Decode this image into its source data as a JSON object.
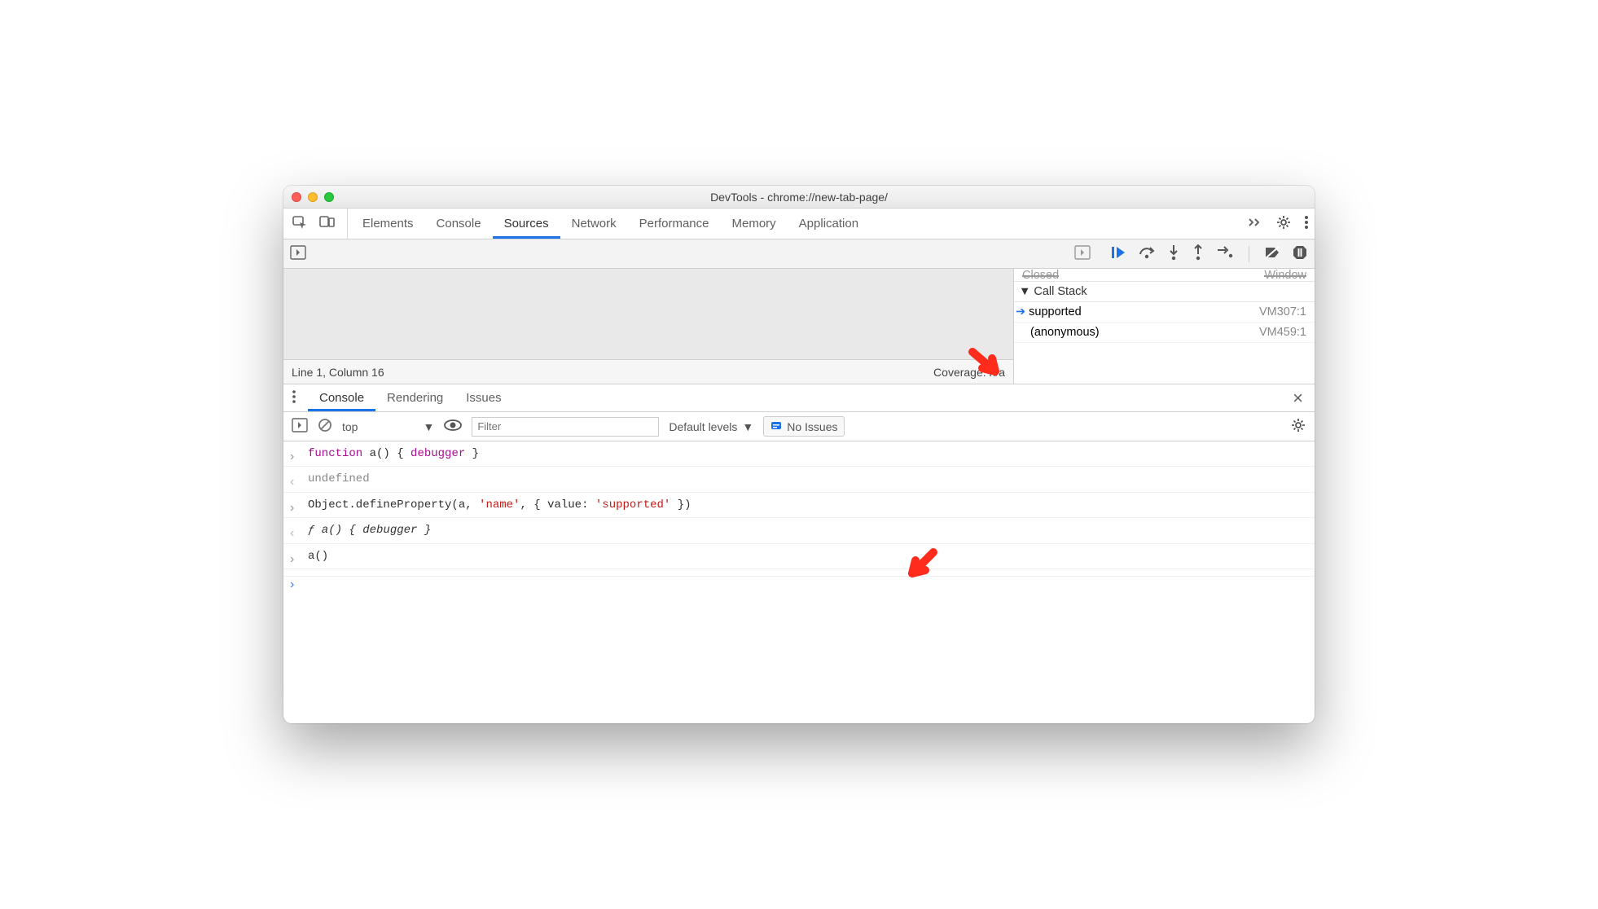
{
  "window": {
    "title": "DevTools - chrome://new-tab-page/"
  },
  "main_tabs": {
    "items": [
      {
        "label": "Elements"
      },
      {
        "label": "Console"
      },
      {
        "label": "Sources",
        "active": true
      },
      {
        "label": "Network"
      },
      {
        "label": "Performance"
      },
      {
        "label": "Memory"
      },
      {
        "label": "Application"
      }
    ]
  },
  "src_status": {
    "left": "Line 1, Column 16",
    "right": "Coverage: n/a"
  },
  "truncated": {
    "left": "Closed",
    "right": "Window"
  },
  "call_stack": {
    "title": "Call Stack",
    "frames": [
      {
        "name": "supported",
        "loc": "VM307:1",
        "active": true
      },
      {
        "name": "(anonymous)",
        "loc": "VM459:1",
        "active": false
      }
    ]
  },
  "drawer_tabs": {
    "items": [
      {
        "label": "Console",
        "active": true
      },
      {
        "label": "Rendering"
      },
      {
        "label": "Issues"
      }
    ]
  },
  "console_toolbar": {
    "context": "top",
    "filter_placeholder": "Filter",
    "levels": "Default levels",
    "issues_chip": "No Issues"
  },
  "console_lines": [
    {
      "kind": "input",
      "segments": [
        {
          "t": "function ",
          "c": "kw"
        },
        {
          "t": "a() { "
        },
        {
          "t": "debugger",
          "c": "kw"
        },
        {
          "t": " }"
        }
      ]
    },
    {
      "kind": "output",
      "segments": [
        {
          "t": "undefined",
          "c": "undef"
        }
      ]
    },
    {
      "kind": "input",
      "segments": [
        {
          "t": "Object.defineProperty(a, "
        },
        {
          "t": "'name'",
          "c": "str"
        },
        {
          "t": ", { value: "
        },
        {
          "t": "'supported'",
          "c": "str"
        },
        {
          "t": " })"
        }
      ]
    },
    {
      "kind": "output",
      "segments": [
        {
          "t": "ƒ a() { debugger }",
          "c": "ital"
        }
      ]
    },
    {
      "kind": "input",
      "segments": [
        {
          "t": "a()"
        }
      ]
    },
    {
      "kind": "prompt",
      "segments": []
    }
  ]
}
